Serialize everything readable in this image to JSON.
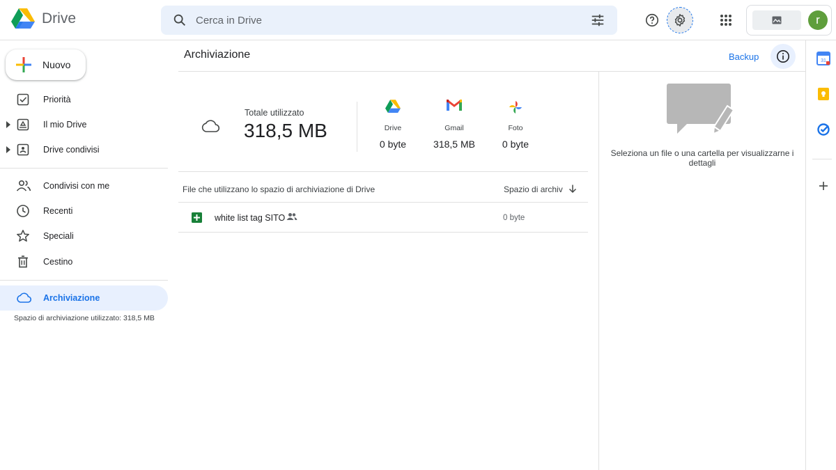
{
  "app": {
    "name": "Drive",
    "search_placeholder": "Cerca in Drive",
    "account_initial": "r"
  },
  "header_icons": [
    "search-icon",
    "tune-icon",
    "help-icon",
    "settings-icon",
    "apps-grid-icon"
  ],
  "sidebar": {
    "new_label": "Nuovo",
    "items": [
      {
        "label": "Priorità",
        "icon": "priority-check-icon"
      },
      {
        "label": "Il mio Drive",
        "icon": "my-drive-icon"
      },
      {
        "label": "Drive condivisi",
        "icon": "shared-drives-icon"
      },
      {
        "label": "Condivisi con me",
        "icon": "people-icon"
      },
      {
        "label": "Recenti",
        "icon": "clock-icon"
      },
      {
        "label": "Speciali",
        "icon": "star-icon"
      },
      {
        "label": "Cestino",
        "icon": "trash-icon"
      },
      {
        "label": "Archiviazione",
        "icon": "cloud-icon",
        "active": true
      }
    ],
    "storage_note": "Spazio di archiviazione utilizzato: 318,5 MB"
  },
  "main": {
    "title": "Archiviazione",
    "backup_label": "Backup",
    "total_label": "Totale utilizzato",
    "total_value": "318,5 MB",
    "services": [
      {
        "name": "Drive",
        "value": "0 byte"
      },
      {
        "name": "Gmail",
        "value": "318,5 MB"
      },
      {
        "name": "Foto",
        "value": "0 byte"
      }
    ],
    "list_header": "File che utilizzano lo spazio di archiviazione di Drive",
    "sort_label": "Spazio di archiv",
    "files": [
      {
        "name": "white list tag SITO",
        "size": "0 byte",
        "shared": true
      }
    ]
  },
  "details": {
    "message": "Seleziona un file o una cartella per visualizzarne i dettagli"
  },
  "colors": {
    "accent": "#1a73e8",
    "active_bg": "#e8f0fe",
    "search_bg": "#eaf1fb",
    "avatar": "#5f9e3c"
  }
}
